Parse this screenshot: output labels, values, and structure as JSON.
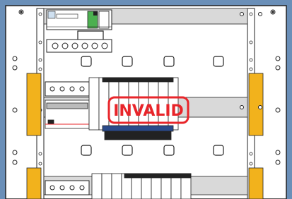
{
  "diagram": {
    "background_color": "#6a8fb8",
    "panel_color": "#ffffff",
    "line_color": "#222222",
    "accent_yellow": "#f2b21c",
    "accent_green": "#4cb050",
    "accent_red": "#e8252a",
    "stamp": {
      "text": "INVALID",
      "color": "#e8252a"
    },
    "rows": [
      {
        "name": "top-row-main-breaker",
        "module_count": 6
      },
      {
        "name": "middle-row-rcd-and-breakers",
        "module_count": 12
      },
      {
        "name": "bottom-row-breakers",
        "module_count": 12
      }
    ],
    "cutouts_per_row": 4
  }
}
